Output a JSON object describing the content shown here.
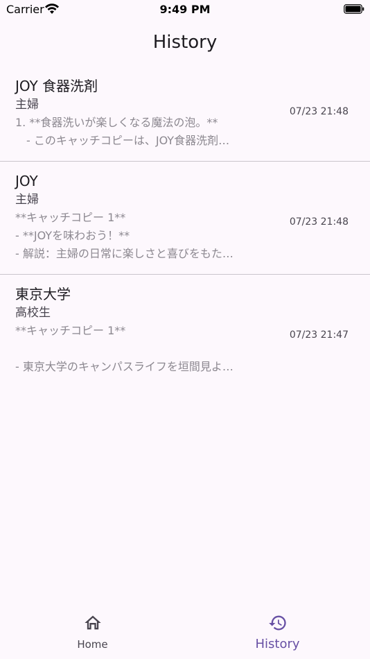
{
  "status_bar": {
    "carrier": "Carrier",
    "time": "9:49 PM"
  },
  "header": {
    "title": "History"
  },
  "history": [
    {
      "title": "JOY 食器洗剤",
      "target": "主婦",
      "preview": [
        "1. **食器洗いが楽しくなる魔法の泡。**",
        "　- このキャッチコピーは、JOY食器洗剤…"
      ],
      "date": "07/23 21:48"
    },
    {
      "title": "JOY",
      "target": "主婦",
      "preview": [
        "**キャッチコピー 1**",
        "- **JOYを味わおう！**",
        "- 解説：主婦の日常に楽しさと喜びをもた…"
      ],
      "date": "07/23 21:48"
    },
    {
      "title": "東京大学",
      "target": "高校生",
      "preview": [
        "**キャッチコピー 1**",
        "",
        "- 東京大学のキャンパスライフを垣間見よ…"
      ],
      "date": "07/23 21:47"
    }
  ],
  "bottom_nav": {
    "home_label": "Home",
    "history_label": "History",
    "active": "history"
  },
  "colors": {
    "background": "#fdf8fd",
    "accent": "#6750a4",
    "divider": "#c9c5cc"
  },
  "icons": {
    "wifi": "wifi-icon",
    "battery": "battery-icon",
    "home": "home-icon",
    "history": "history-icon"
  }
}
